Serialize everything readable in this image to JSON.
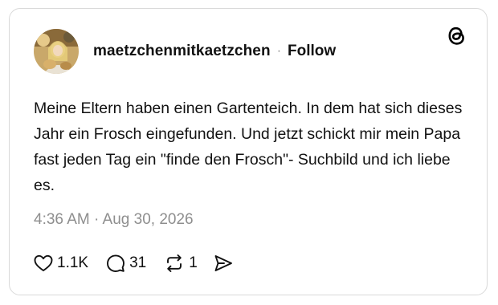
{
  "post": {
    "username": "maetzchenmitkaetzchen",
    "separator": "·",
    "follow_label": "Follow",
    "text": "Meine Eltern haben einen Gartenteich. In dem hat sich dieses Jahr ein Frosch eingefunden. Und jetzt schickt mir mein Papa fast jeden Tag ein \"finde den Frosch\"- Suchbild und ich liebe es.",
    "timestamp": "4:36 AM · Aug 30, 2026",
    "brand_icon": "threads-logo-icon"
  },
  "actions": {
    "likes": "1.1K",
    "replies": "31",
    "reposts": "1",
    "icons": [
      "heart-icon",
      "comment-icon",
      "repost-icon",
      "share-icon"
    ]
  },
  "colors": {
    "text": "#111111",
    "muted": "#8e8e8e",
    "border": "#d9d9d9"
  }
}
